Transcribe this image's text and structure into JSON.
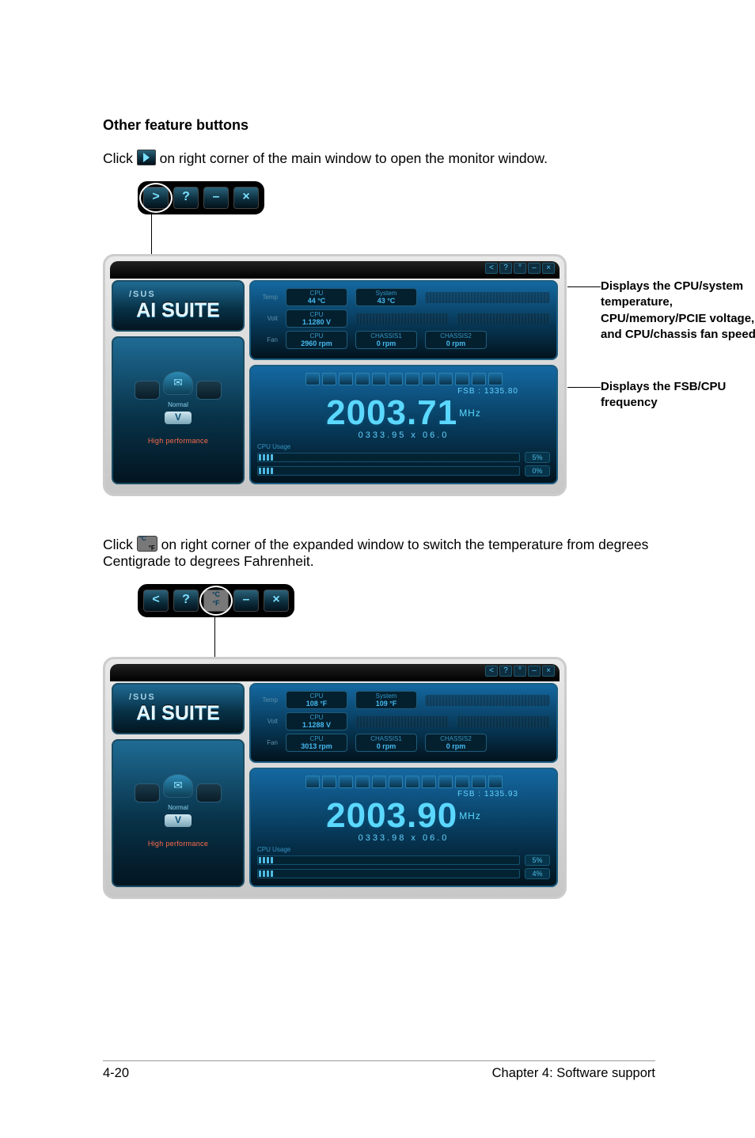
{
  "header": {
    "title": "Other feature buttons",
    "para1_a": "Click ",
    "para1_b": " on right corner of the main window to open the monitor window.",
    "para2_a": "Click ",
    "para2_b": " on right corner of the expanded window to switch the temperature from degrees Centigrade to degrees Fahrenheit."
  },
  "callouts": {
    "stats": "Displays the CPU/system temperature, CPU/memory/PCIE voltage, and CPU/chassis fan speed",
    "freq": "Displays the FSB/CPU frequency"
  },
  "toolbar1": {
    "expand": ">",
    "help": "?",
    "minimize": "–",
    "close": "×"
  },
  "toolbar2": {
    "collapse": "<",
    "help": "?",
    "switch": "°C°F",
    "minimize": "–",
    "close": "×"
  },
  "mini_buttons": [
    "<",
    "?",
    "°",
    "–",
    "×"
  ],
  "brand": {
    "asus": "/SUS",
    "suite": "AI SUITE"
  },
  "mode": {
    "left": "",
    "center": "✉",
    "right": "",
    "normal_label": "Normal",
    "v": "V",
    "perf": "High performance"
  },
  "app1": {
    "readings": {
      "row1": {
        "label": "Temp",
        "c1_t": "CPU",
        "c1_v": "44 °C",
        "c2_t": "System",
        "c2_v": "43 °C"
      },
      "row2": {
        "label": "Volt",
        "c1_t": "CPU",
        "c1_v": "1.1280 V"
      },
      "row3": {
        "label": "Fan",
        "c1_t": "CPU",
        "c1_v": "2960 rpm",
        "c2_t": "CHASSIS1",
        "c2_v": "0 rpm",
        "c3_t": "CHASSIS2",
        "c3_v": "0 rpm"
      }
    },
    "freq": {
      "fsb": "FSB : 1335.80",
      "big": "2003.71",
      "unit": "MHz",
      "sub": "0333.95 x 06.0",
      "usage_lbl": "CPU Usage",
      "u1": "5%",
      "u2": "0%"
    }
  },
  "app2": {
    "readings": {
      "row1": {
        "label": "Temp",
        "c1_t": "CPU",
        "c1_v": "108 °F",
        "c2_t": "System",
        "c2_v": "109 °F"
      },
      "row2": {
        "label": "Volt",
        "c1_t": "CPU",
        "c1_v": "1.1288 V"
      },
      "row3": {
        "label": "Fan",
        "c1_t": "CPU",
        "c1_v": "3013 rpm",
        "c2_t": "CHASSIS1",
        "c2_v": "0 rpm",
        "c3_t": "CHASSIS2",
        "c3_v": "0 rpm"
      }
    },
    "freq": {
      "fsb": "FSB : 1335.93",
      "big": "2003.90",
      "unit": "MHz",
      "sub": "0333.98 x 06.0",
      "usage_lbl": "CPU Usage",
      "u1": "5%",
      "u2": "4%"
    }
  },
  "footer": {
    "left": "4-20",
    "right": "Chapter 4: Software support"
  }
}
